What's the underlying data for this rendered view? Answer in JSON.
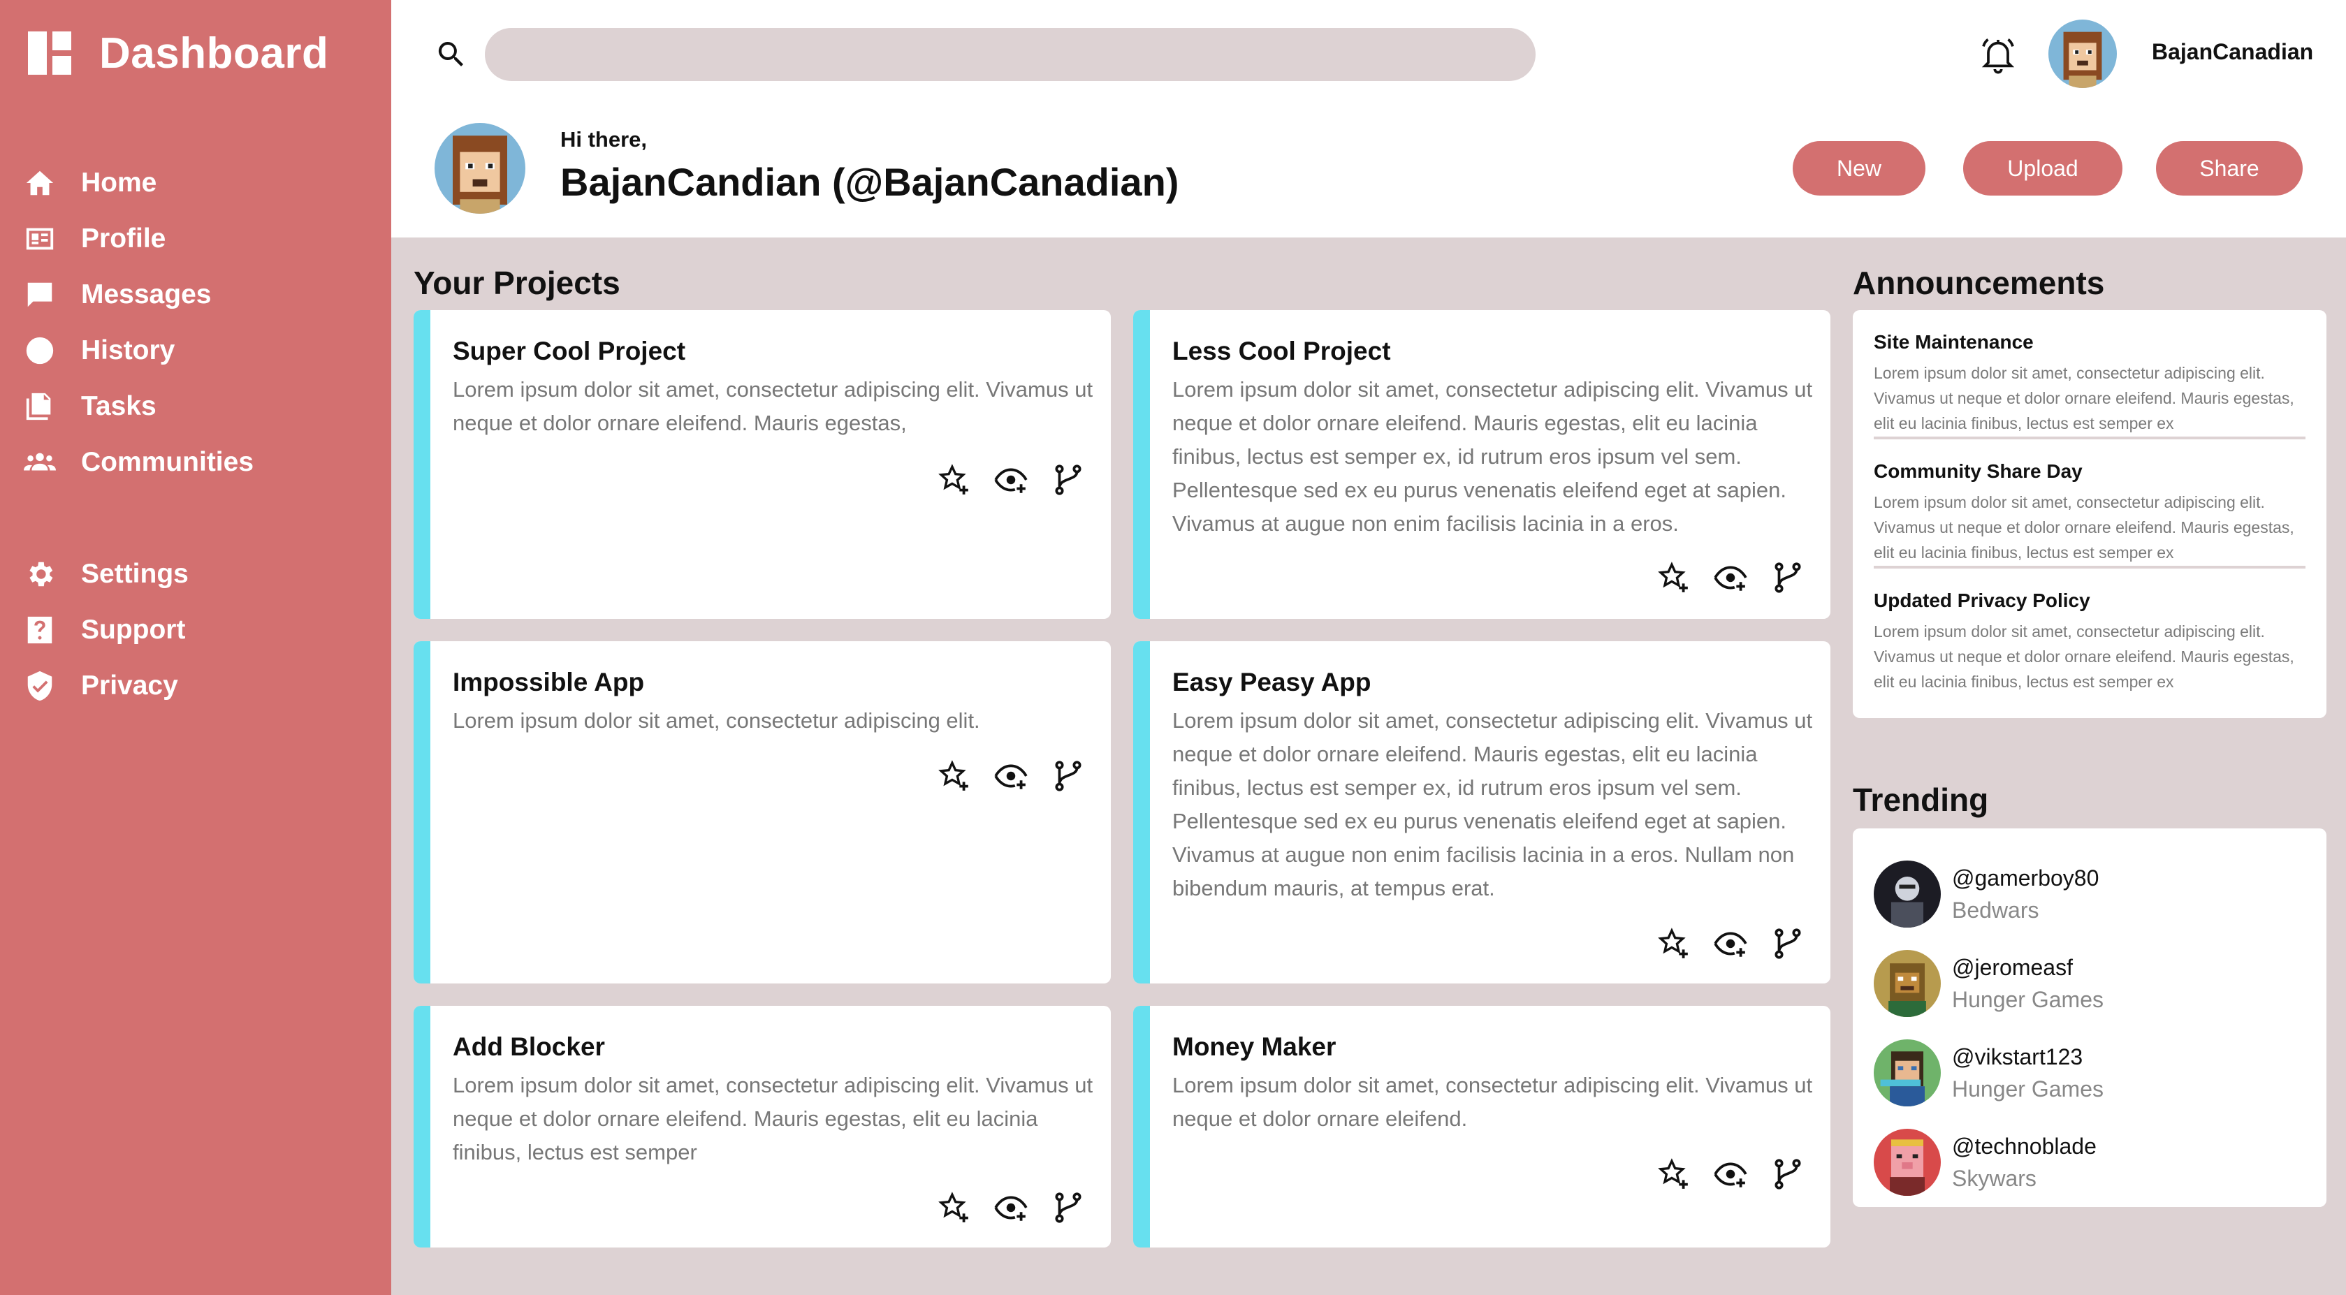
{
  "sidebar": {
    "title": "Dashboard",
    "items": [
      {
        "label": "Home",
        "icon": "home-icon"
      },
      {
        "label": "Profile",
        "icon": "id-card-icon"
      },
      {
        "label": "Messages",
        "icon": "chat-bubble-icon"
      },
      {
        "label": "History",
        "icon": "clock-icon"
      },
      {
        "label": "Tasks",
        "icon": "documents-icon"
      },
      {
        "label": "Communities",
        "icon": "people-icon"
      }
    ],
    "secondary": [
      {
        "label": "Settings",
        "icon": "gear-icon"
      },
      {
        "label": "Support",
        "icon": "help-icon"
      },
      {
        "label": "Privacy",
        "icon": "shield-icon"
      }
    ]
  },
  "header": {
    "search_placeholder": "",
    "username": "BajanCanadian",
    "greeting": "Hi there,",
    "full_name": "BajanCandian (@BajanCanadian)",
    "buttons": {
      "new": "New",
      "upload": "Upload",
      "share": "Share"
    }
  },
  "projects": {
    "title": "Your Projects",
    "items": [
      {
        "title": "Super Cool Project",
        "description": "Lorem ipsum dolor sit amet, consectetur adipiscing elit. Vivamus ut neque et dolor ornare eleifend. Mauris egestas,"
      },
      {
        "title": "Less Cool Project",
        "description": "Lorem ipsum dolor sit amet, consectetur adipiscing elit. Vivamus ut neque et dolor ornare eleifend. Mauris egestas, elit eu lacinia finibus, lectus est semper ex, id rutrum eros ipsum vel sem. Pellentesque sed ex eu purus venenatis eleifend eget at sapien. Vivamus at augue non enim facilisis lacinia in a eros."
      },
      {
        "title": "Impossible App",
        "description": "Lorem ipsum dolor sit amet, consectetur adipiscing elit."
      },
      {
        "title": "Easy Peasy App",
        "description": "Lorem ipsum dolor sit amet, consectetur adipiscing elit. Vivamus ut neque et dolor ornare eleifend. Mauris egestas, elit eu lacinia finibus, lectus est semper ex, id rutrum eros ipsum vel sem. Pellentesque sed ex eu purus venenatis eleifend eget at sapien. Vivamus at augue non enim facilisis lacinia in a eros. Nullam non bibendum mauris, at tempus erat."
      },
      {
        "title": "Add Blocker",
        "description": "Lorem ipsum dolor sit amet, consectetur adipiscing elit. Vivamus ut neque et dolor ornare eleifend. Mauris egestas, elit eu lacinia finibus, lectus est semper"
      },
      {
        "title": "Money Maker",
        "description": "Lorem ipsum dolor sit amet, consectetur adipiscing elit. Vivamus ut neque et dolor ornare eleifend."
      }
    ]
  },
  "announcements": {
    "title": "Announcements",
    "items": [
      {
        "title": "Site Maintenance",
        "body": "Lorem ipsum dolor sit amet, consectetur adipiscing elit. Vivamus ut neque et dolor ornare eleifend. Mauris egestas, elit eu lacinia finibus, lectus est semper ex"
      },
      {
        "title": "Community Share Day",
        "body": "Lorem ipsum dolor sit amet, consectetur adipiscing elit. Vivamus ut neque et dolor ornare eleifend. Mauris egestas, elit eu lacinia finibus, lectus est semper ex"
      },
      {
        "title": "Updated Privacy Policy",
        "body": "Lorem ipsum dolor sit amet, consectetur adipiscing elit. Vivamus ut neque et dolor ornare eleifend. Mauris egestas, elit eu lacinia finibus, lectus est semper ex"
      }
    ]
  },
  "trending": {
    "title": "Trending",
    "items": [
      {
        "handle": "@gamerboy80",
        "game": "Bedwars"
      },
      {
        "handle": "@jeromeasf",
        "game": "Hunger Games"
      },
      {
        "handle": "@vikstart123",
        "game": "Hunger Games"
      },
      {
        "handle": "@technoblade",
        "game": "Skywars"
      }
    ]
  },
  "colors": {
    "sidebar": "#d37070",
    "accent_stripe": "#67e0ef",
    "background": "#ddd2d3",
    "button": "#d37070"
  }
}
